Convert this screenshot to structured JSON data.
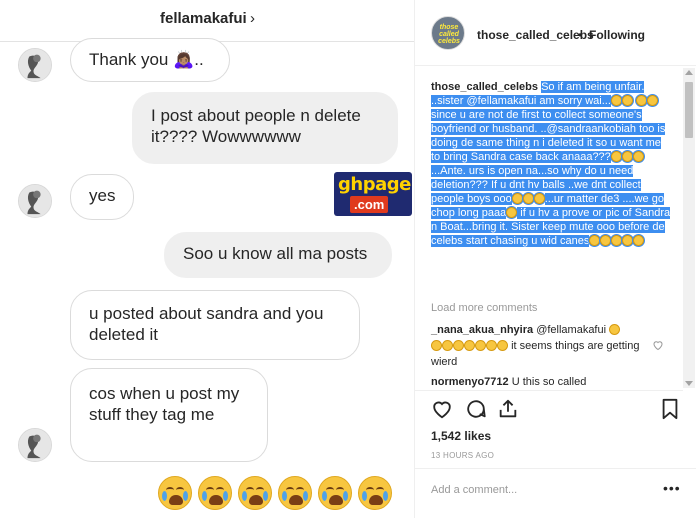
{
  "dm": {
    "username": "fellamakafui",
    "chevron": "›",
    "messages": [
      {
        "side": "in",
        "text": "Thank you 🙇🏽‍♀️..",
        "avatar": "person-avatar"
      },
      {
        "side": "out",
        "text": "I post about people n delete it???? Wowwwwww"
      },
      {
        "side": "in",
        "text": "yes",
        "avatar": "person-avatar"
      },
      {
        "side": "out",
        "text": "Soo u know all ma posts"
      },
      {
        "side": "in",
        "text": "u posted about sandra and you deleted it"
      },
      {
        "side": "in",
        "text": "cos when u post my stuff they tag me",
        "avatar": "person-avatar"
      }
    ],
    "reaction_emojis": [
      "crying-emoji",
      "crying-emoji",
      "crying-emoji",
      "crying-emoji",
      "crying-emoji",
      "crying-emoji"
    ],
    "watermark": {
      "top": "ghpage",
      "bottom": ".com"
    }
  },
  "post": {
    "account_avatar_text": "those called celebs",
    "account": "those_called_celebs",
    "separator": "•",
    "following_label": "Following",
    "caption_user": "those_called_celebs",
    "caption_parts": [
      "So if am being unfair. ..sister @fellamakafui am sorry wai...",
      " since u are not de first to collect someone's boyfriend or husband. ..@sandraankobiah too is doing de same thing n i deleted it so u want me to bring Sandra case back anaaa???",
      "...Ante. urs is open na...so why do u need deletion??? If u dnt hv balls ..we dnt collect people boys ooo",
      "...ur matter de3 ....we go chop long paaa",
      " if u hv a prove or pic of Sandra n Boat...bring it. Sister keep mute ooo before de celebs start chasing u wid canes"
    ],
    "load_more": "Load more comments",
    "comments": [
      {
        "user": "_nana_akua_nhyira",
        "mention": "@fellamakafui",
        "text": " it seems things are getting wierd"
      },
      {
        "user": "normenyo7712",
        "text": "U this so called"
      }
    ],
    "likes": "1,542 likes",
    "time_ago": "13 HOURS AGO",
    "add_comment_placeholder": "Add a comment...",
    "more_options": "•••"
  }
}
